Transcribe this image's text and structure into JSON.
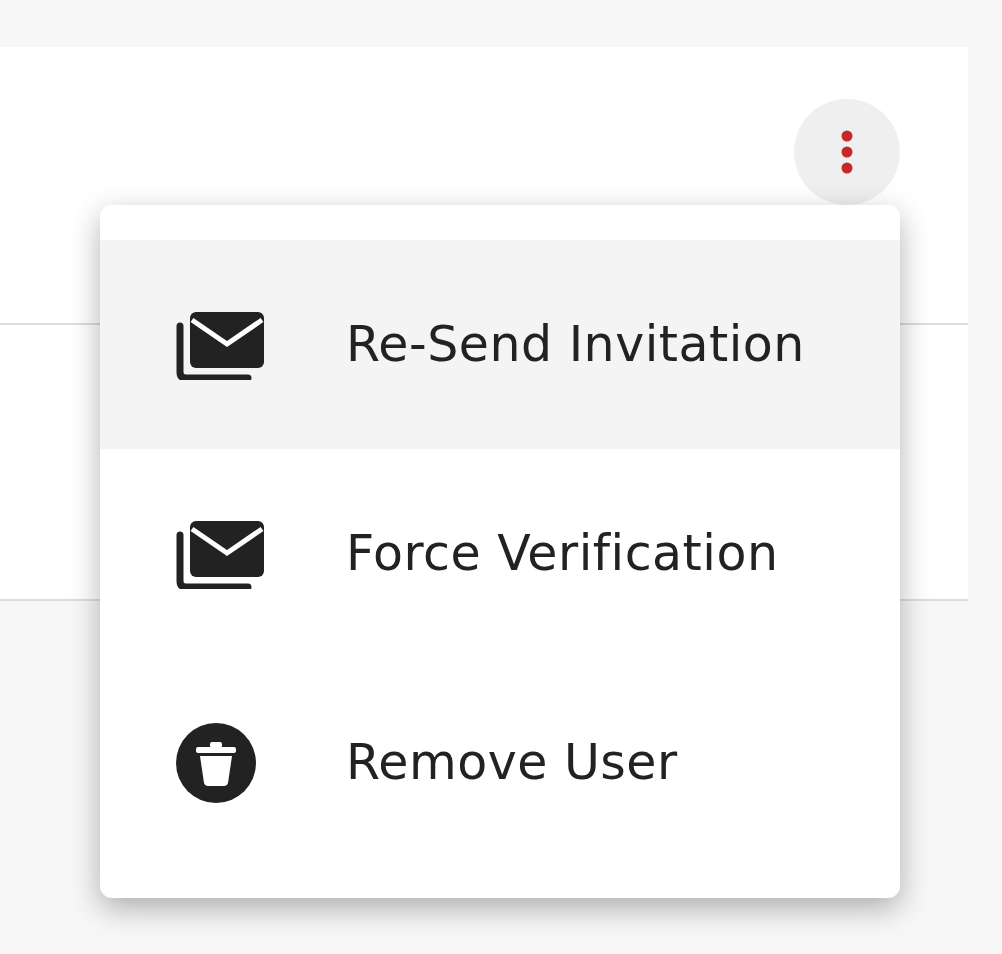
{
  "menu_button": {
    "expanded": true
  },
  "menu": {
    "items": [
      {
        "label": "Re-Send Invitation",
        "kind": "envelope",
        "selected": true
      },
      {
        "label": "Force Verification",
        "kind": "envelope",
        "selected": false
      },
      {
        "label": "Remove User",
        "kind": "trash",
        "selected": false
      }
    ]
  }
}
